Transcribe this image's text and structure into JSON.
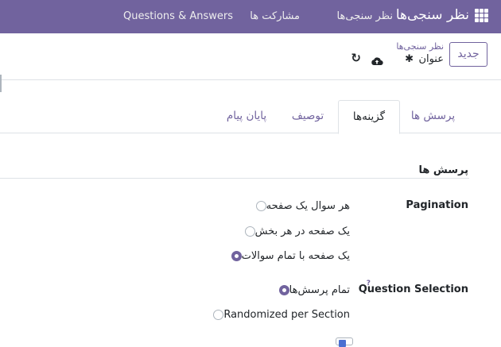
{
  "topbar": {
    "brand": "نظر سنجی‌ها",
    "menu": [
      "نظر سنجی‌ها",
      "مشارکت ها",
      "Questions & Answers"
    ]
  },
  "controlbar": {
    "new_button": "جدید",
    "breadcrumb_parent": "نظر سنجی‌ها",
    "breadcrumb_current": "عنوان"
  },
  "tabs": [
    {
      "label": "پرسش ها",
      "active": false
    },
    {
      "label": "گزینه‌ها",
      "active": true
    },
    {
      "label": "توصیف",
      "active": false
    },
    {
      "label": "پایان پیام",
      "active": false
    }
  ],
  "section": {
    "title": "پرسش ها"
  },
  "pagination": {
    "label": "Pagination",
    "options": [
      {
        "text": "هر سوال یک صفحه",
        "selected": false
      },
      {
        "text": "یک صفحه در هر بخش",
        "selected": false
      },
      {
        "text": "یک صفحه با تمام سوالات",
        "selected": true
      }
    ]
  },
  "question_selection": {
    "label": "Question Selection",
    "help": "?",
    "options": [
      {
        "text": "تمام پرسش‌ها",
        "selected": true
      },
      {
        "text": "Randomized per Section",
        "selected": false
      }
    ]
  },
  "colors": {
    "accent": "#71639e",
    "topbar": "#71639e",
    "border": "#dee2e6"
  },
  "icons": {
    "apps": "apps-grid-icon",
    "settings": "gear-icon",
    "save": "cloud-upload-icon",
    "discard": "undo-icon"
  }
}
